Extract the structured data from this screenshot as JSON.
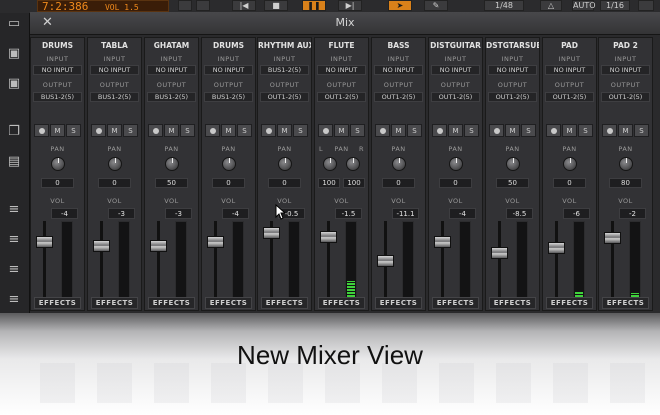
{
  "topbar": {
    "time": "7:2:386",
    "vol_label": "VOL 1.5",
    "position": "1/48",
    "auto": "AUTO",
    "zoom": "1/16"
  },
  "mixer": {
    "title": "Mix",
    "close": "✕"
  },
  "channels": [
    {
      "name": "DRUMS",
      "input_label": "INPUT",
      "input": "NO INPUT",
      "output_label": "OUTPUT",
      "output": "BUS1-2(5)",
      "pan_label": "PAN",
      "pan": "0",
      "vol_label": "VOL",
      "vol": "-4",
      "effects": "EFFECTS"
    },
    {
      "name": "TABLA",
      "input_label": "INPUT",
      "input": "NO INPUT",
      "output_label": "OUTPUT",
      "output": "BUS1-2(5)",
      "pan_label": "PAN",
      "pan": "0",
      "vol_label": "VOL",
      "vol": "-3",
      "effects": "EFFECTS"
    },
    {
      "name": "GHATAM",
      "input_label": "INPUT",
      "input": "NO INPUT",
      "output_label": "OUTPUT",
      "output": "BUS1-2(5)",
      "pan_label": "PAN",
      "pan": "50",
      "vol_label": "VOL",
      "vol": "-3",
      "effects": "EFFECTS"
    },
    {
      "name": "DRUMS",
      "input_label": "INPUT",
      "input": "NO INPUT",
      "output_label": "OUTPUT",
      "output": "BUS1-2(5)",
      "pan_label": "PAN",
      "pan": "0",
      "vol_label": "VOL",
      "vol": "-4",
      "effects": "EFFECTS"
    },
    {
      "name": "RHYTHM AUX",
      "input_label": "INPUT",
      "input": "BUS1-2(5)",
      "output_label": "OUTPUT",
      "output": "OUT1-2(5)",
      "pan_label": "PAN",
      "pan": "0",
      "vol_label": "VOL",
      "vol": "-0.5",
      "effects": "EFFECTS"
    },
    {
      "name": "FLUTE",
      "input_label": "INPUT",
      "input": "NO INPUT",
      "output_label": "OUTPUT",
      "output": "OUT1-2(5)",
      "pan_label": "PAN",
      "pan_l_label": "L",
      "pan_r_label": "R",
      "pan_l": "100",
      "pan_r": "100",
      "vol_label": "VOL",
      "vol": "-1.5",
      "effects": "EFFECTS"
    },
    {
      "name": "BASS",
      "input_label": "INPUT",
      "input": "NO INPUT",
      "output_label": "OUTPUT",
      "output": "OUT1-2(5)",
      "pan_label": "PAN",
      "pan": "0",
      "vol_label": "VOL",
      "vol": "-11.1",
      "effects": "EFFECTS"
    },
    {
      "name": "DISTGUITAR",
      "input_label": "INPUT",
      "input": "NO INPUT",
      "output_label": "OUTPUT",
      "output": "OUT1-2(5)",
      "pan_label": "PAN",
      "pan": "0",
      "vol_label": "VOL",
      "vol": "-4",
      "effects": "EFFECTS"
    },
    {
      "name": "DSTGTARSUB",
      "input_label": "INPUT",
      "input": "NO INPUT",
      "output_label": "OUTPUT",
      "output": "OUT1-2(5)",
      "pan_label": "PAN",
      "pan": "50",
      "vol_label": "VOL",
      "vol": "-8.5",
      "effects": "EFFECTS"
    },
    {
      "name": "PAD",
      "input_label": "INPUT",
      "input": "NO INPUT",
      "output_label": "OUTPUT",
      "output": "OUT1-2(5)",
      "pan_label": "PAN",
      "pan": "0",
      "vol_label": "VOL",
      "vol": "-6",
      "effects": "EFFECTS"
    },
    {
      "name": "PAD 2",
      "input_label": "INPUT",
      "input": "NO INPUT",
      "output_label": "OUTPUT",
      "output": "OUT1-2(5)",
      "pan_label": "PAN",
      "pan": "80",
      "vol_label": "VOL",
      "vol": "-2",
      "effects": "EFFECTS"
    }
  ],
  "strip_buttons": {
    "mute": "M",
    "solo": "S"
  },
  "meter_levels": [
    0,
    0,
    0,
    0,
    0,
    0.22,
    0,
    0,
    0,
    0.08,
    0.05
  ],
  "fader_levels": [
    0.78,
    0.73,
    0.73,
    0.78,
    0.92,
    0.86,
    0.52,
    0.78,
    0.63,
    0.7,
    0.85
  ],
  "caption": "New Mixer View",
  "colors": {
    "accent": "#d9811a",
    "meter": "#3fd23b",
    "lcd": "#f08a1c"
  }
}
